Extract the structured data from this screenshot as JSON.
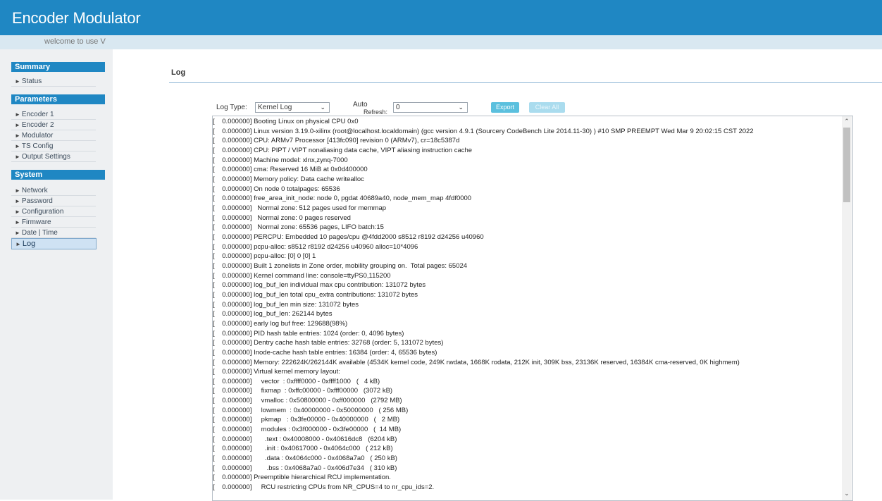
{
  "header": {
    "title": "Encoder Modulator"
  },
  "welcome": {
    "text": "welcome to use V"
  },
  "sidebar": {
    "sections": [
      {
        "title": "Summary",
        "items": [
          "Status"
        ]
      },
      {
        "title": "Parameters",
        "items": [
          "Encoder 1",
          "Encoder 2",
          "Modulator",
          "TS Config",
          "Output Settings"
        ]
      },
      {
        "title": "System",
        "items": [
          "Network",
          "Password",
          "Configuration",
          "Firmware",
          "Date | Time",
          "Log"
        ]
      }
    ],
    "active_item": "Log"
  },
  "main": {
    "heading": "Log",
    "toolbar": {
      "log_type_label": "Log Type:",
      "log_type_value": "Kernel Log",
      "auto_refresh_label": "Auto",
      "auto_refresh_label_cut": "Refresh:",
      "auto_refresh_value": "0",
      "export_label": "Export",
      "second_button_label": "Clear All"
    },
    "log_lines": [
      "[    0.000000] Booting Linux on physical CPU 0x0",
      "[    0.000000] Linux version 3.19.0-xilinx (root@localhost.localdomain) (gcc version 4.9.1 (Sourcery CodeBench Lite 2014.11-30) ) #10 SMP PREEMPT Wed Mar 9 20:02:15 CST 2022",
      "[    0.000000] CPU: ARMv7 Processor [413fc090] revision 0 (ARMv7), cr=18c5387d",
      "[    0.000000] CPU: PIPT / VIPT nonaliasing data cache, VIPT aliasing instruction cache",
      "[    0.000000] Machine model: xlnx,zynq-7000",
      "[    0.000000] cma: Reserved 16 MiB at 0x0d400000",
      "[    0.000000] Memory policy: Data cache writealloc",
      "[    0.000000] On node 0 totalpages: 65536",
      "[    0.000000] free_area_init_node: node 0, pgdat 40689a40, node_mem_map 4fdf0000",
      "[    0.000000]   Normal zone: 512 pages used for memmap",
      "[    0.000000]   Normal zone: 0 pages reserved",
      "[    0.000000]   Normal zone: 65536 pages, LIFO batch:15",
      "[    0.000000] PERCPU: Embedded 10 pages/cpu @4fdd2000 s8512 r8192 d24256 u40960",
      "[    0.000000] pcpu-alloc: s8512 r8192 d24256 u40960 alloc=10*4096",
      "[    0.000000] pcpu-alloc: [0] 0 [0] 1",
      "[    0.000000] Built 1 zonelists in Zone order, mobility grouping on.  Total pages: 65024",
      "[    0.000000] Kernel command line: console=ttyPS0,115200",
      "[    0.000000] log_buf_len individual max cpu contribution: 131072 bytes",
      "[    0.000000] log_buf_len total cpu_extra contributions: 131072 bytes",
      "[    0.000000] log_buf_len min size: 131072 bytes",
      "[    0.000000] log_buf_len: 262144 bytes",
      "[    0.000000] early log buf free: 129688(98%)",
      "[    0.000000] PID hash table entries: 1024 (order: 0, 4096 bytes)",
      "[    0.000000] Dentry cache hash table entries: 32768 (order: 5, 131072 bytes)",
      "[    0.000000] Inode-cache hash table entries: 16384 (order: 4, 65536 bytes)",
      "[    0.000000] Memory: 222624K/262144K available (4534K kernel code, 249K rwdata, 1668K rodata, 212K init, 309K bss, 23136K reserved, 16384K cma-reserved, 0K highmem)",
      "[    0.000000] Virtual kernel memory layout:",
      "[    0.000000]     vector  : 0xffff0000 - 0xffff1000   (   4 kB)",
      "[    0.000000]     fixmap  : 0xffc00000 - 0xfff00000   (3072 kB)",
      "[    0.000000]     vmalloc : 0x50800000 - 0xff000000   (2792 MB)",
      "[    0.000000]     lowmem  : 0x40000000 - 0x50000000   ( 256 MB)",
      "[    0.000000]     pkmap   : 0x3fe00000 - 0x40000000   (   2 MB)",
      "[    0.000000]     modules : 0x3f000000 - 0x3fe00000   (  14 MB)",
      "[    0.000000]       .text : 0x40008000 - 0x40616dc8   (6204 kB)",
      "[    0.000000]       .init : 0x40617000 - 0x4064c000   ( 212 kB)",
      "[    0.000000]       .data : 0x4064c000 - 0x4068a7a0   ( 250 kB)",
      "[    0.000000]        .bss : 0x4068a7a0 - 0x406d7e34   ( 310 kB)",
      "[    0.000000] Preemptible hierarchical RCU implementation.",
      "[    0.000000]     RCU restricting CPUs from NR_CPUS=4 to nr_cpu_ids=2."
    ]
  },
  "colors": {
    "header_bg": "#1f87c3",
    "welcome_bg": "#d9e8f1",
    "sidebar_bg": "#eef0f2",
    "button_bg": "#5bc0de"
  }
}
